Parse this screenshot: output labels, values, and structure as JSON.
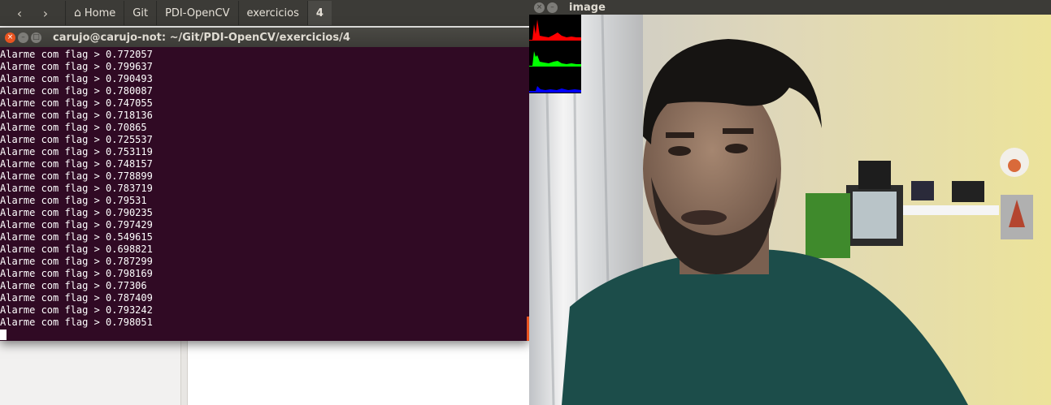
{
  "file_manager": {
    "nav": {
      "back_icon": "chevron-left-icon",
      "forward_icon": "chevron-right-icon"
    },
    "breadcrumbs": [
      {
        "label": "Home",
        "icon": "home-icon"
      },
      {
        "label": "Git"
      },
      {
        "label": "PDI-OpenCV"
      },
      {
        "label": "exercicios"
      },
      {
        "label": "4"
      }
    ]
  },
  "terminal": {
    "title": "carujo@carujo-not: ~/Git/PDI-OpenCV/exercicios/4",
    "lines": [
      "Alarme com flag > 0.772057",
      "Alarme com flag > 0.799637",
      "Alarme com flag > 0.790493",
      "Alarme com flag > 0.780087",
      "Alarme com flag > 0.747055",
      "Alarme com flag > 0.718136",
      "Alarme com flag > 0.70865",
      "Alarme com flag > 0.725537",
      "Alarme com flag > 0.753119",
      "Alarme com flag > 0.748157",
      "Alarme com flag > 0.778899",
      "Alarme com flag > 0.783719",
      "Alarme com flag > 0.79531",
      "Alarme com flag > 0.790235",
      "Alarme com flag > 0.797429",
      "Alarme com flag > 0.549615",
      "Alarme com flag > 0.698821",
      "Alarme com flag > 0.787299",
      "Alarme com flag > 0.798169",
      "Alarme com flag > 0.77306",
      "Alarme com flag > 0.787409",
      "Alarme com flag > 0.793242",
      "Alarme com flag > 0.798051"
    ],
    "colors": {
      "background": "#300a24",
      "text": "#ffffff"
    }
  },
  "image_window": {
    "title": "image",
    "histograms": [
      {
        "channel": "red",
        "color": "#ff0000"
      },
      {
        "channel": "green",
        "color": "#00ff00"
      },
      {
        "channel": "blue",
        "color": "#0000ff"
      }
    ]
  }
}
